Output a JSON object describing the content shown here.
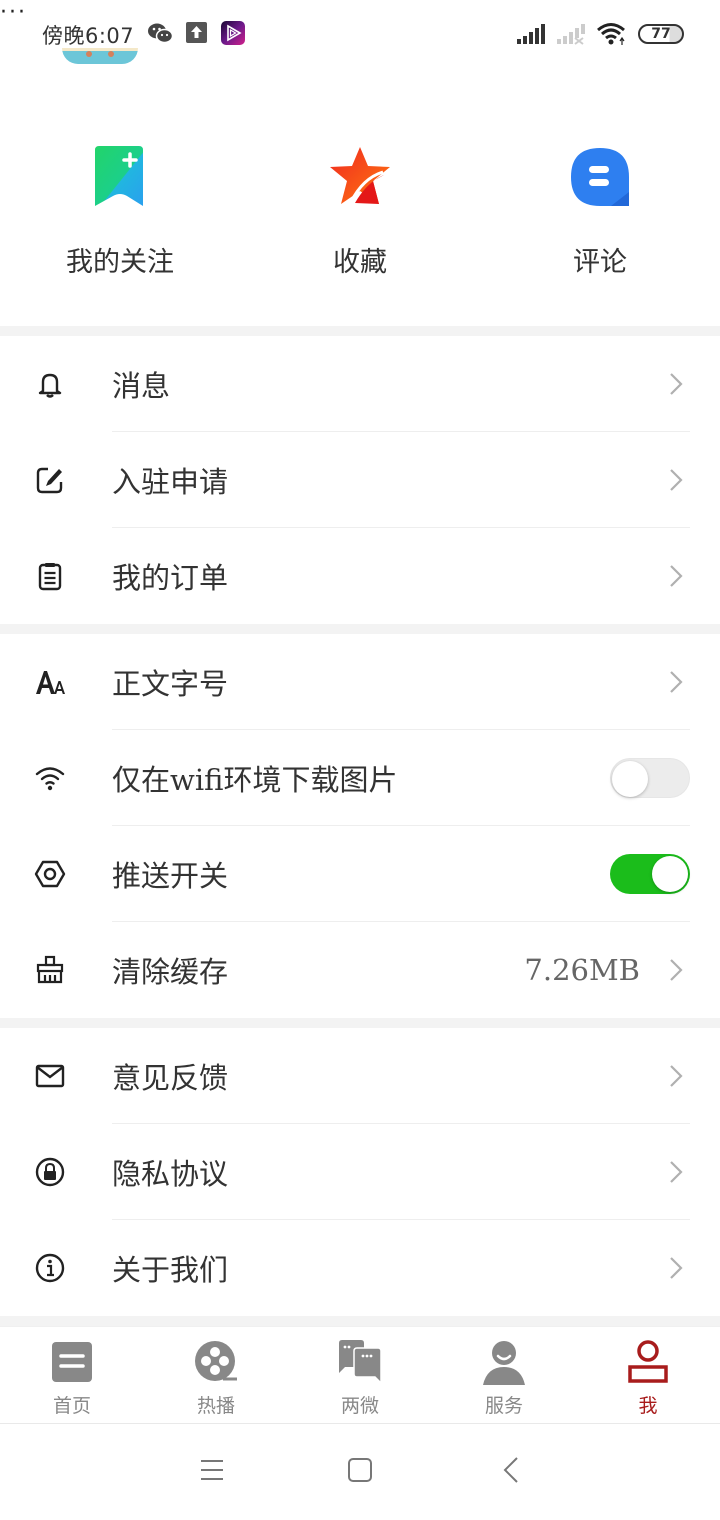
{
  "status_bar": {
    "time": "傍晚6:07",
    "notification_icons": [
      "wechat-icon",
      "upload-icon",
      "video-app-icon"
    ],
    "more": "···",
    "battery": "77",
    "signal_icons": [
      "signal-sim1-icon",
      "signal-sim2-icon",
      "wifi-icon"
    ]
  },
  "quick_actions": [
    {
      "label": "我的关注",
      "icon": "bookmark-plus-icon"
    },
    {
      "label": "收藏",
      "icon": "star-icon"
    },
    {
      "label": "评论",
      "icon": "comment-icon"
    }
  ],
  "menu_groups": [
    [
      {
        "label": "消息",
        "icon": "bell-icon",
        "type": "link"
      },
      {
        "label": "入驻申请",
        "icon": "edit-icon",
        "type": "link"
      },
      {
        "label": "我的订单",
        "icon": "clipboard-icon",
        "type": "link"
      }
    ],
    [
      {
        "label": "正文字号",
        "icon": "font-size-icon",
        "type": "link"
      },
      {
        "label": "仅在wifi环境下载图片",
        "icon": "wifi-icon",
        "type": "toggle",
        "checked": false
      },
      {
        "label": "推送开关",
        "icon": "hexagon-icon",
        "type": "toggle",
        "checked": true
      },
      {
        "label": "清除缓存",
        "icon": "broom-icon",
        "type": "link",
        "value": "7.26MB"
      }
    ],
    [
      {
        "label": "意见反馈",
        "icon": "mail-icon",
        "type": "link"
      },
      {
        "label": "隐私协议",
        "icon": "lock-icon",
        "type": "link"
      },
      {
        "label": "关于我们",
        "icon": "info-icon",
        "type": "link"
      }
    ]
  ],
  "tab_bar": {
    "active_color": "#a81c1c",
    "inactive_color": "#888888",
    "tabs": [
      {
        "label": "首页",
        "icon": "news-icon",
        "active": false
      },
      {
        "label": "热播",
        "icon": "film-reel-icon",
        "active": false
      },
      {
        "label": "两微",
        "icon": "chat-bubbles-icon",
        "active": false
      },
      {
        "label": "服务",
        "icon": "person-service-icon",
        "active": false
      },
      {
        "label": "我",
        "icon": "profile-icon",
        "active": true
      }
    ]
  },
  "toggle_on_color": "#1bbd1b",
  "nav_bar": [
    "menu-icon",
    "home-icon",
    "back-icon"
  ]
}
